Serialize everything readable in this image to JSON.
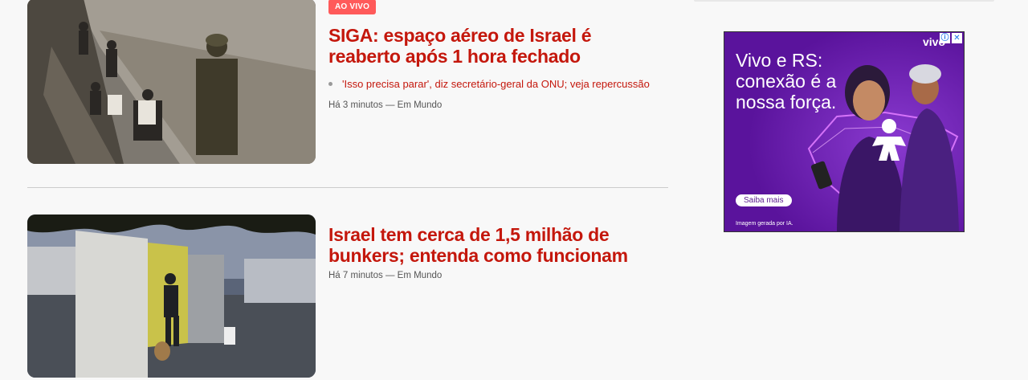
{
  "feed": {
    "items": [
      {
        "badge": "AO VIVO",
        "headline": "SIGA: espaço aéreo de Israel é reaberto após 1 hora fechado",
        "related": [
          "'Isso precisa parar', diz secretário-geral da ONU; veja repercussão"
        ],
        "meta": "Há 3 minutos — Em Mundo"
      },
      {
        "headline": "Israel tem cerca de 1,5 milhão de bunkers; entenda como funcionam",
        "meta": "Há 7 minutos — Em Mundo"
      }
    ]
  },
  "ad": {
    "headline": "Vivo e RS: conexão é a nossa força.",
    "brand": "vivo",
    "cta": "Saiba mais",
    "disclaimer": "Imagem gerada por IA.",
    "info_icon": "info-icon",
    "close_icon": "close-icon",
    "colors": {
      "background": "#6b1fb0",
      "glow": "#e07bff"
    }
  },
  "colors": {
    "headline": "#c4170c",
    "badge": "#ff5a5a"
  }
}
